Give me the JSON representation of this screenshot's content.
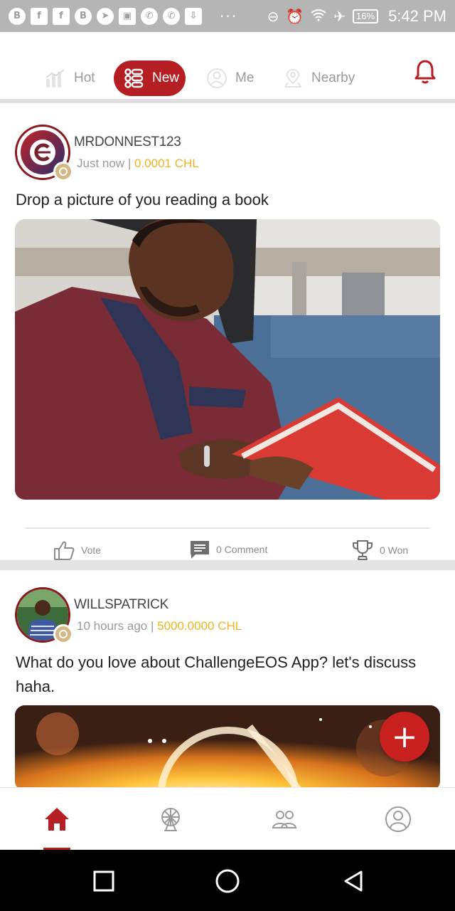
{
  "status_bar": {
    "left_icons": [
      "B",
      "f",
      "f",
      "B",
      "telegram",
      "gallery",
      "phone",
      "phone",
      "download"
    ],
    "overflow": "···",
    "battery": "16%",
    "time": "5:42 PM"
  },
  "tabs": [
    {
      "label": "Hot",
      "icon": "chart-icon"
    },
    {
      "label": "New",
      "icon": "list-icon"
    },
    {
      "label": "Me",
      "icon": "person-icon"
    },
    {
      "label": "Nearby",
      "icon": "pin-icon"
    }
  ],
  "active_tab": "New",
  "colors": {
    "accent": "#b51f23",
    "amount": "#f1b323",
    "fab": "#c8211f",
    "badge": "#d4b885"
  },
  "posts": [
    {
      "username": "MRDONNEST123",
      "time": "Just now",
      "separator": "|",
      "amount": "0.0001 CHL",
      "text": "Drop a picture of you reading a book",
      "actions": {
        "vote": "Vote",
        "comment": "0 Comment",
        "won": "0 Won"
      }
    },
    {
      "username": "WILLSPATRICK",
      "time": "10 hours ago",
      "separator": "|",
      "amount": "5000.0000 CHL",
      "text": "What do you love about ChallengeEOS App? let's discuss haha."
    }
  ],
  "fab": {
    "label": "+"
  },
  "bottom_nav": [
    "home-icon",
    "ferris-wheel-icon",
    "group-icon",
    "profile-icon"
  ]
}
